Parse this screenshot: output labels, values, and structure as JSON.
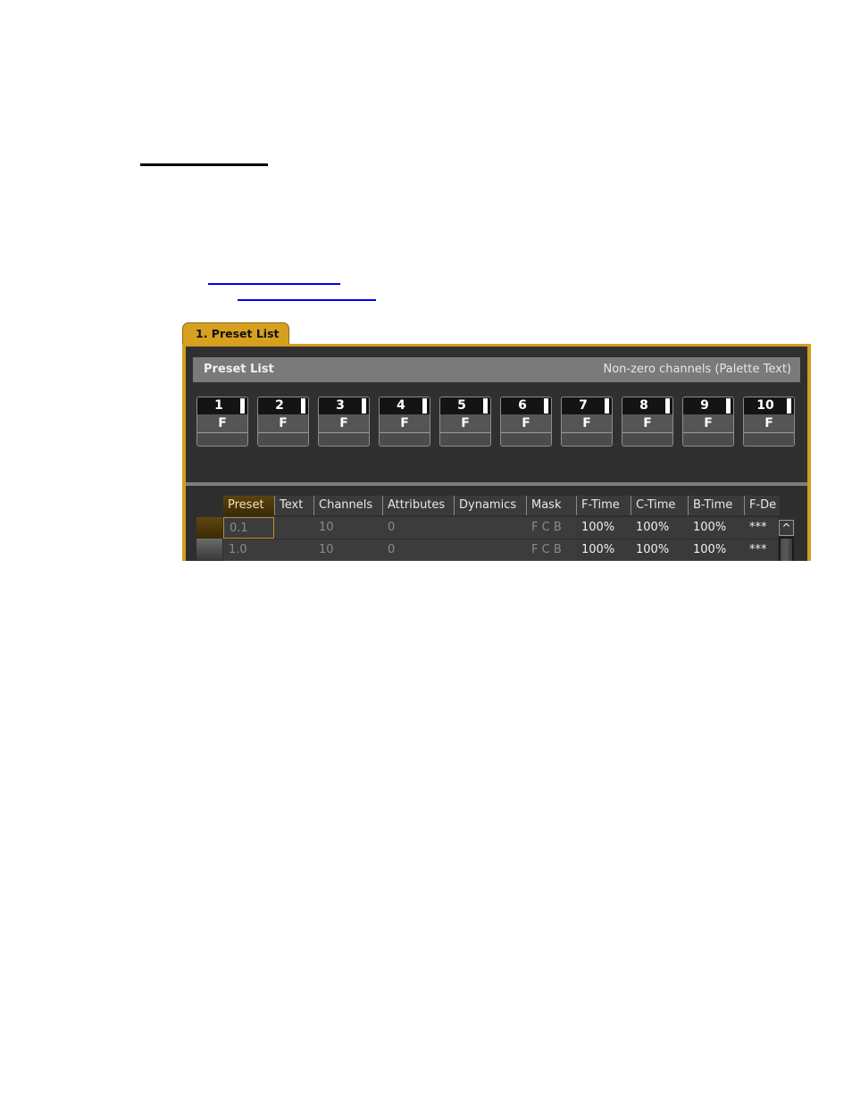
{
  "document": {
    "links": [
      "",
      ""
    ]
  },
  "tab": {
    "label": "1. Preset List"
  },
  "window": {
    "header": {
      "title": "Preset List",
      "subtitle": "Non-zero channels (Palette Text)"
    },
    "presets": [
      {
        "number": "1",
        "mode": "F"
      },
      {
        "number": "2",
        "mode": "F"
      },
      {
        "number": "3",
        "mode": "F"
      },
      {
        "number": "4",
        "mode": "F"
      },
      {
        "number": "5",
        "mode": "F"
      },
      {
        "number": "6",
        "mode": "F"
      },
      {
        "number": "7",
        "mode": "F"
      },
      {
        "number": "8",
        "mode": "F"
      },
      {
        "number": "9",
        "mode": "F"
      },
      {
        "number": "10",
        "mode": "F"
      }
    ],
    "table": {
      "columns": [
        "Preset",
        "Text",
        "Channels",
        "Attributes",
        "Dynamics",
        "Mask",
        "F-Time",
        "C-Time",
        "B-Time",
        "F-De"
      ],
      "rows": [
        {
          "preset": "0.1",
          "text": "",
          "channels": "10",
          "attributes": "0",
          "dynamics": "",
          "mask": "F C B",
          "f_time": "100%",
          "c_time": "100%",
          "b_time": "100%",
          "f_delay": "***"
        },
        {
          "preset": "1.0",
          "text": "",
          "channels": "10",
          "attributes": "0",
          "dynamics": "",
          "mask": "F C B",
          "f_time": "100%",
          "c_time": "100%",
          "b_time": "100%",
          "f_delay": "***"
        }
      ],
      "scroll_up_glyph": "^"
    }
  },
  "colors": {
    "accent": "#d59d1c",
    "panel": "#303030",
    "header": "#7a7a7a"
  }
}
